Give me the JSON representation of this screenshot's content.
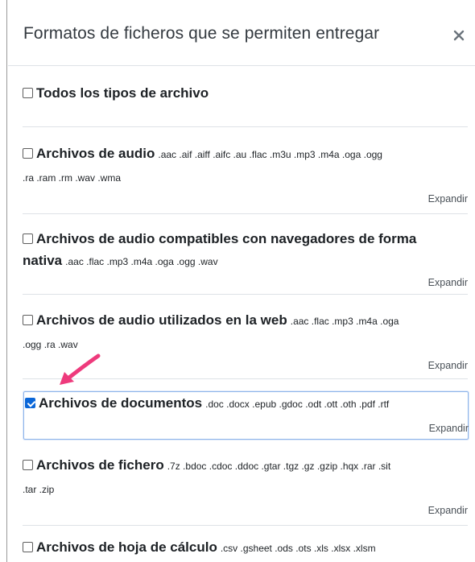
{
  "modal": {
    "title": "Formatos de ficheros que se permiten entregar",
    "close_icon": "close-icon"
  },
  "all_types": {
    "label": "Todos los tipos de archivo",
    "checked": false
  },
  "groups": [
    {
      "name": "Archivos de audio",
      "line1_ext": ".aac .aif .aiff .aifc .au .flac .m3u .mp3 .m4a .oga .ogg",
      "line2_ext": ".ra .ram .rm .wav .wma",
      "expand": "Expandir",
      "checked": false
    },
    {
      "name_line1": "Archivos de audio compatibles con navegadores de forma",
      "name_line2": "nativa",
      "line2_ext": ".aac .flac .mp3 .m4a .oga .ogg .wav",
      "expand": "Expandir",
      "checked": false
    },
    {
      "name": "Archivos de audio utilizados en la web",
      "line1_ext": ".aac .flac .mp3 .m4a .oga",
      "line2_ext": ".ogg .ra .wav",
      "expand": "Expandir",
      "checked": false
    },
    {
      "name": "Archivos de documentos",
      "line1_ext": ".doc .docx .epub .gdoc .odt .ott .oth .pdf .rtf",
      "expand": "Expandir",
      "checked": true
    },
    {
      "name": "Archivos de fichero",
      "line1_ext": ".7z .bdoc .cdoc .ddoc .gtar .tgz .gz .gzip .hqx .rar .sit",
      "line2_ext": ".tar .zip",
      "expand": "Expandir",
      "checked": false
    },
    {
      "name": "Archivos de hoja de cálculo",
      "line1_ext": ".csv .gsheet .ods .ots .xls .xlsx .xlsm",
      "checked": false
    }
  ],
  "annotation": {
    "arrow_color": "#ee3a7c",
    "icon": "pointer-arrow-icon"
  },
  "colors": {
    "checkbox_checked": "#0a66d8",
    "focus_border": "#8fb5ea"
  }
}
